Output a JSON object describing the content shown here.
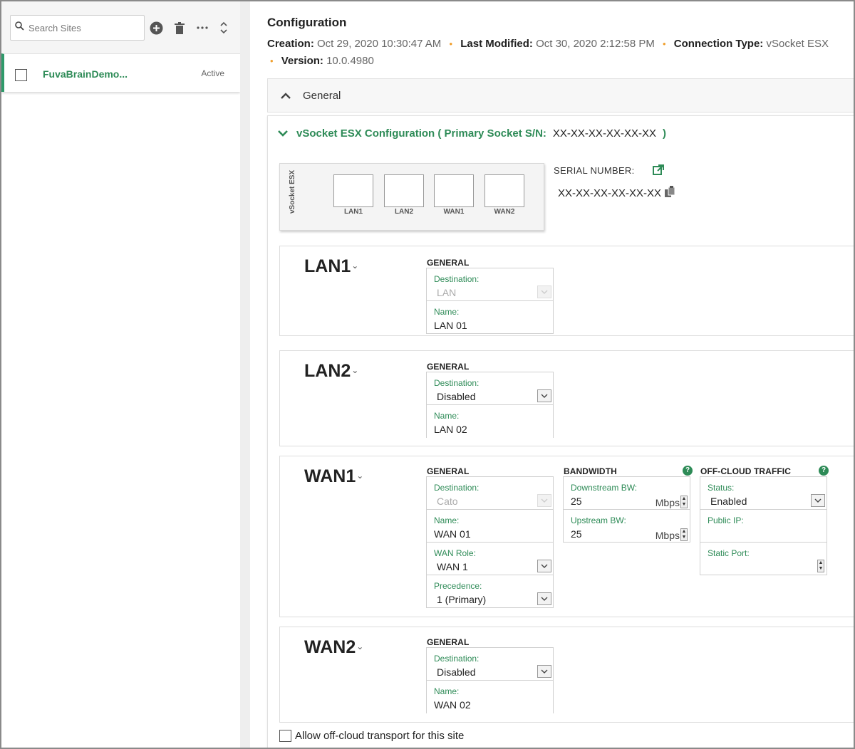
{
  "sidebar": {
    "search_placeholder": "Search Sites",
    "tools": [
      "add-icon",
      "trash-icon",
      "more-icon",
      "sort-icon"
    ],
    "sites": [
      {
        "name": "FuvaBrainDemo...",
        "status": "Active"
      }
    ]
  },
  "config": {
    "title": "Configuration",
    "creation_label": "Creation:",
    "creation_value": "Oct 29, 2020 10:30:47 AM",
    "modified_label": "Last Modified:",
    "modified_value": "Oct 30, 2020 2:12:58 PM",
    "conn_label": "Connection Type:",
    "conn_value": "vSocket ESX",
    "version_label": "Version:",
    "version_value": "10.0.4980",
    "separator": "•"
  },
  "general": {
    "label": "General"
  },
  "esx": {
    "title": "vSocket ESX Configuration ( Primary Socket S/N:",
    "serial": "XX-XX-XX-XX-XX-XX",
    "close": ")",
    "device_label": "vSocket ESX",
    "ports": [
      "LAN1",
      "LAN2",
      "WAN1",
      "WAN2"
    ],
    "serial_label": "SERIAL NUMBER:",
    "serial_value": "XX-XX-XX-XX-XX-XX"
  },
  "sections": {
    "general": "GENERAL",
    "bandwidth": "BANDWIDTH",
    "offcloud": "OFF-CLOUD TRAFFIC"
  },
  "lan1": {
    "name": "LAN1",
    "dest_label": "Destination:",
    "dest_value": "LAN",
    "name_label": "Name:",
    "name_value": "LAN 01"
  },
  "lan2": {
    "name": "LAN2",
    "dest_label": "Destination:",
    "dest_value": "Disabled",
    "name_label": "Name:",
    "name_value": "LAN 02"
  },
  "wan1": {
    "name": "WAN1",
    "dest_label": "Destination:",
    "dest_value": "Cato",
    "name_label": "Name:",
    "name_value": "WAN 01",
    "role_label": "WAN Role:",
    "role_value": "WAN 1",
    "prec_label": "Precedence:",
    "prec_value": "1 (Primary)",
    "down_label": "Downstream BW:",
    "down_value": "25",
    "down_unit": "Mbps",
    "up_label": "Upstream BW:",
    "up_value": "25",
    "up_unit": "Mbps",
    "status_label": "Status:",
    "status_value": "Enabled",
    "ip_label": "Public IP:",
    "port_label": "Static Port:"
  },
  "wan2": {
    "name": "WAN2",
    "dest_label": "Destination:",
    "dest_value": "Disabled",
    "name_label": "Name:",
    "name_value": "WAN 02"
  },
  "footer": {
    "allow_label": "Allow off-cloud transport for this site"
  },
  "colors": {
    "accent": "#2e8b57",
    "separator": "#f0a030"
  }
}
